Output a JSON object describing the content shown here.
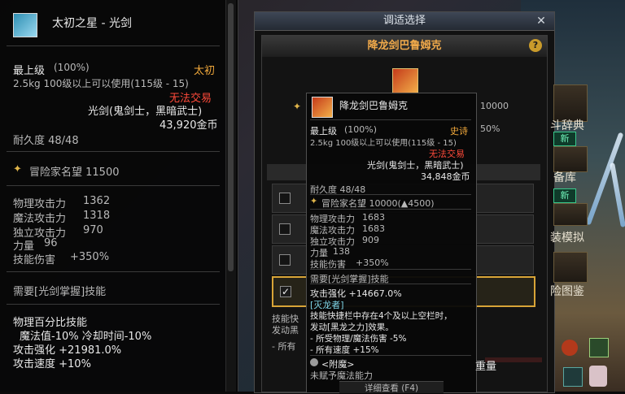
{
  "left_tooltip": {
    "title": "太初之星 - 光剑",
    "grade": "最上级",
    "grade_pct": "(100%)",
    "rarity": "太初",
    "weight_level": "2.5kg   100级以上可以使用(115级 - 15)",
    "trade": "无法交易",
    "class_req": "光剑(鬼剑士，黑暗武士)",
    "price": "43,920金币",
    "durability": "耐久度 48/48",
    "renown": "冒险家名望 11500",
    "stats": [
      {
        "name": "物理攻击力",
        "value": "1362"
      },
      {
        "name": "魔法攻击力",
        "value": "1318"
      },
      {
        "name": "独立攻击力",
        "value": "970"
      },
      {
        "name": "力量",
        "value": "96"
      },
      {
        "name": "技能伤害",
        "value": "+350%"
      }
    ],
    "requirement": "需要[光剑掌握]技能",
    "skill_lines": [
      "物理百分比技能",
      "魔法值-10% 冷却时间-10%",
      "攻击强化 +21981.0%",
      "攻击速度 +10%"
    ]
  },
  "window": {
    "title": "调适选择",
    "close": "✕",
    "panel_title": "降龙剑巴鲁姆克",
    "help": "?",
    "behind_value": "10000",
    "behind_pct": "50%",
    "behind_text_1": "技能快",
    "behind_text_2": "发动黑",
    "behind_text_3": "- 所有"
  },
  "center_tooltip": {
    "name": "降龙剑巴鲁姆克",
    "grade": "最上级",
    "grade_pct": "(100%)",
    "rarity": "史诗",
    "weight_level": "2.5kg  100级以上可以使用(115级 - 15)",
    "trade": "无法交易",
    "class_req": "光剑(鬼剑士，黑暗武士)",
    "price": "34,848金币",
    "durability": "耐久度 48/48",
    "renown": "冒险家名望 10000(▲4500)",
    "stats": [
      {
        "name": "物理攻击力",
        "value": "1683"
      },
      {
        "name": "魔法攻击力",
        "value": "1683"
      },
      {
        "name": "独立攻击力",
        "value": "909"
      },
      {
        "name": "力量",
        "value": "138"
      },
      {
        "name": "技能伤害",
        "value": "+350%"
      }
    ],
    "requirement": "需要[光剑掌握]技能",
    "attack_boost": "攻击强化 +14667.0%",
    "set_name": "[灭龙者]",
    "effect_1": "技能快捷栏中存在4个及以上空栏时，",
    "effect_2": "发动[黑龙之力]效果。",
    "effect_3": "- 所受物理/魔法伤害 -5%",
    "effect_4": "- 所有速度 +15%",
    "enchant_title": "<附魔>",
    "enchant_none": "未赋予魔法能力",
    "detail_btn": "详细查看 (F4)"
  },
  "right_menu": [
    {
      "label": "斗辞典"
    },
    {
      "label": "新"
    },
    {
      "label": "备库"
    },
    {
      "label": "新"
    },
    {
      "label": "装模拟"
    },
    {
      "label": "险图鉴"
    }
  ],
  "bottom_hud": {
    "label": "重量"
  },
  "colors": {
    "orange": "#f2a93b",
    "red": "#ff4a3a",
    "gold": "#e9c36a",
    "cyan": "#7fd6e8"
  }
}
